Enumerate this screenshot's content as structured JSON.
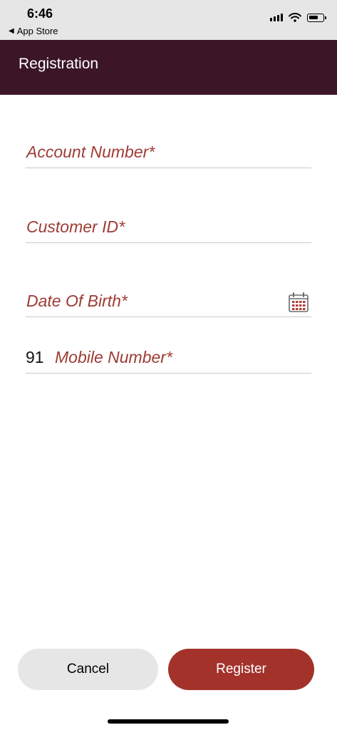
{
  "status_bar": {
    "time": "6:46",
    "back_app": "App Store"
  },
  "header": {
    "title": "Registration"
  },
  "form": {
    "account_number_placeholder": "Account Number*",
    "customer_id_placeholder": "Customer ID*",
    "dob_placeholder": "Date Of Birth*",
    "mobile_prefix": "91",
    "mobile_placeholder": "Mobile Number*"
  },
  "actions": {
    "cancel_label": "Cancel",
    "register_label": "Register"
  },
  "colors": {
    "header_bg": "#3c1627",
    "accent": "#a3322b",
    "placeholder": "#9e3b35"
  },
  "icons": {
    "calendar": "calendar-icon",
    "back": "back-triangle-icon",
    "signal": "cellular-signal-icon",
    "wifi": "wifi-icon",
    "battery": "battery-icon"
  }
}
